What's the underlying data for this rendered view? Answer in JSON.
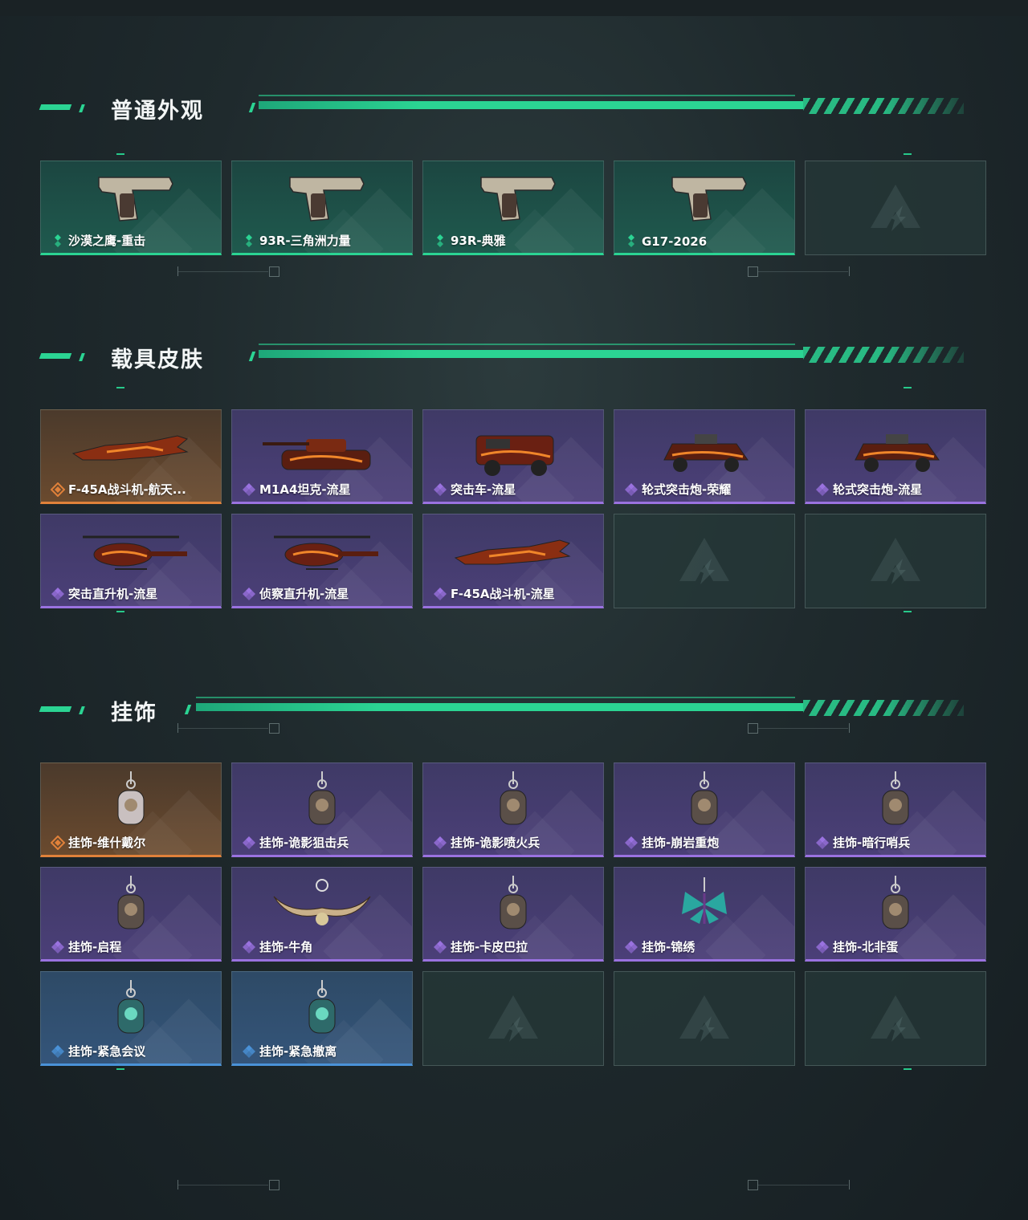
{
  "sections": [
    {
      "title": "普通外观",
      "items": [
        {
          "label": "沙漠之鹰-重击",
          "rarity": "green",
          "icon": "pistol-icon"
        },
        {
          "label": "93R-三角洲力量",
          "rarity": "green",
          "icon": "pistol-icon"
        },
        {
          "label": "93R-典雅",
          "rarity": "green",
          "icon": "pistol-icon"
        },
        {
          "label": "G17-2026",
          "rarity": "green",
          "icon": "pistol-icon"
        },
        {
          "label": "",
          "rarity": "empty",
          "icon": "delta-logo-icon"
        }
      ]
    },
    {
      "title": "载具皮肤",
      "items": [
        {
          "label": "F-45A战斗机-航天...",
          "rarity": "orange",
          "icon": "jet-icon"
        },
        {
          "label": "M1A4坦克-流星",
          "rarity": "purple",
          "icon": "tank-icon"
        },
        {
          "label": "突击车-流星",
          "rarity": "purple",
          "icon": "truck-icon"
        },
        {
          "label": "轮式突击炮-荣耀",
          "rarity": "purple",
          "icon": "armored-car-icon"
        },
        {
          "label": "轮式突击炮-流星",
          "rarity": "purple",
          "icon": "armored-car-icon"
        },
        {
          "label": "突击直升机-流星",
          "rarity": "purple",
          "icon": "helicopter-icon"
        },
        {
          "label": "侦察直升机-流星",
          "rarity": "purple",
          "icon": "helicopter-icon"
        },
        {
          "label": "F-45A战斗机-流星",
          "rarity": "purple",
          "icon": "jet-icon"
        },
        {
          "label": "",
          "rarity": "empty",
          "icon": "delta-logo-icon"
        },
        {
          "label": "",
          "rarity": "empty",
          "icon": "delta-logo-icon"
        }
      ]
    },
    {
      "title": "挂饰",
      "items": [
        {
          "label": "挂饰-维什戴尔",
          "rarity": "orange",
          "icon": "charm-icon"
        },
        {
          "label": "挂饰-诡影狙击兵",
          "rarity": "purple",
          "icon": "charm-icon"
        },
        {
          "label": "挂饰-诡影喷火兵",
          "rarity": "purple",
          "icon": "charm-icon"
        },
        {
          "label": "挂饰-崩岩重炮",
          "rarity": "purple",
          "icon": "charm-icon"
        },
        {
          "label": "挂饰-暗行哨兵",
          "rarity": "purple",
          "icon": "charm-icon"
        },
        {
          "label": "挂饰-启程",
          "rarity": "purple",
          "icon": "charm-icon"
        },
        {
          "label": "挂饰-牛角",
          "rarity": "purple",
          "icon": "horn-charm-icon"
        },
        {
          "label": "挂饰-卡皮巴拉",
          "rarity": "purple",
          "icon": "charm-icon"
        },
        {
          "label": "挂饰-锦绣",
          "rarity": "purple",
          "icon": "butterfly-charm-icon"
        },
        {
          "label": "挂饰-北非蛋",
          "rarity": "purple",
          "icon": "charm-icon"
        },
        {
          "label": "挂饰-紧急会议",
          "rarity": "blue",
          "icon": "charm-icon"
        },
        {
          "label": "挂饰-紧急撤离",
          "rarity": "blue",
          "icon": "charm-icon"
        },
        {
          "label": "",
          "rarity": "empty",
          "icon": "delta-logo-icon"
        },
        {
          "label": "",
          "rarity": "empty",
          "icon": "delta-logo-icon"
        },
        {
          "label": "",
          "rarity": "empty",
          "icon": "delta-logo-icon"
        }
      ]
    }
  ],
  "colors": {
    "accent": "#2bd493",
    "green": "#2bd493",
    "purple": "#9a72e0",
    "orange": "#e0813a",
    "blue": "#4a92d8"
  }
}
